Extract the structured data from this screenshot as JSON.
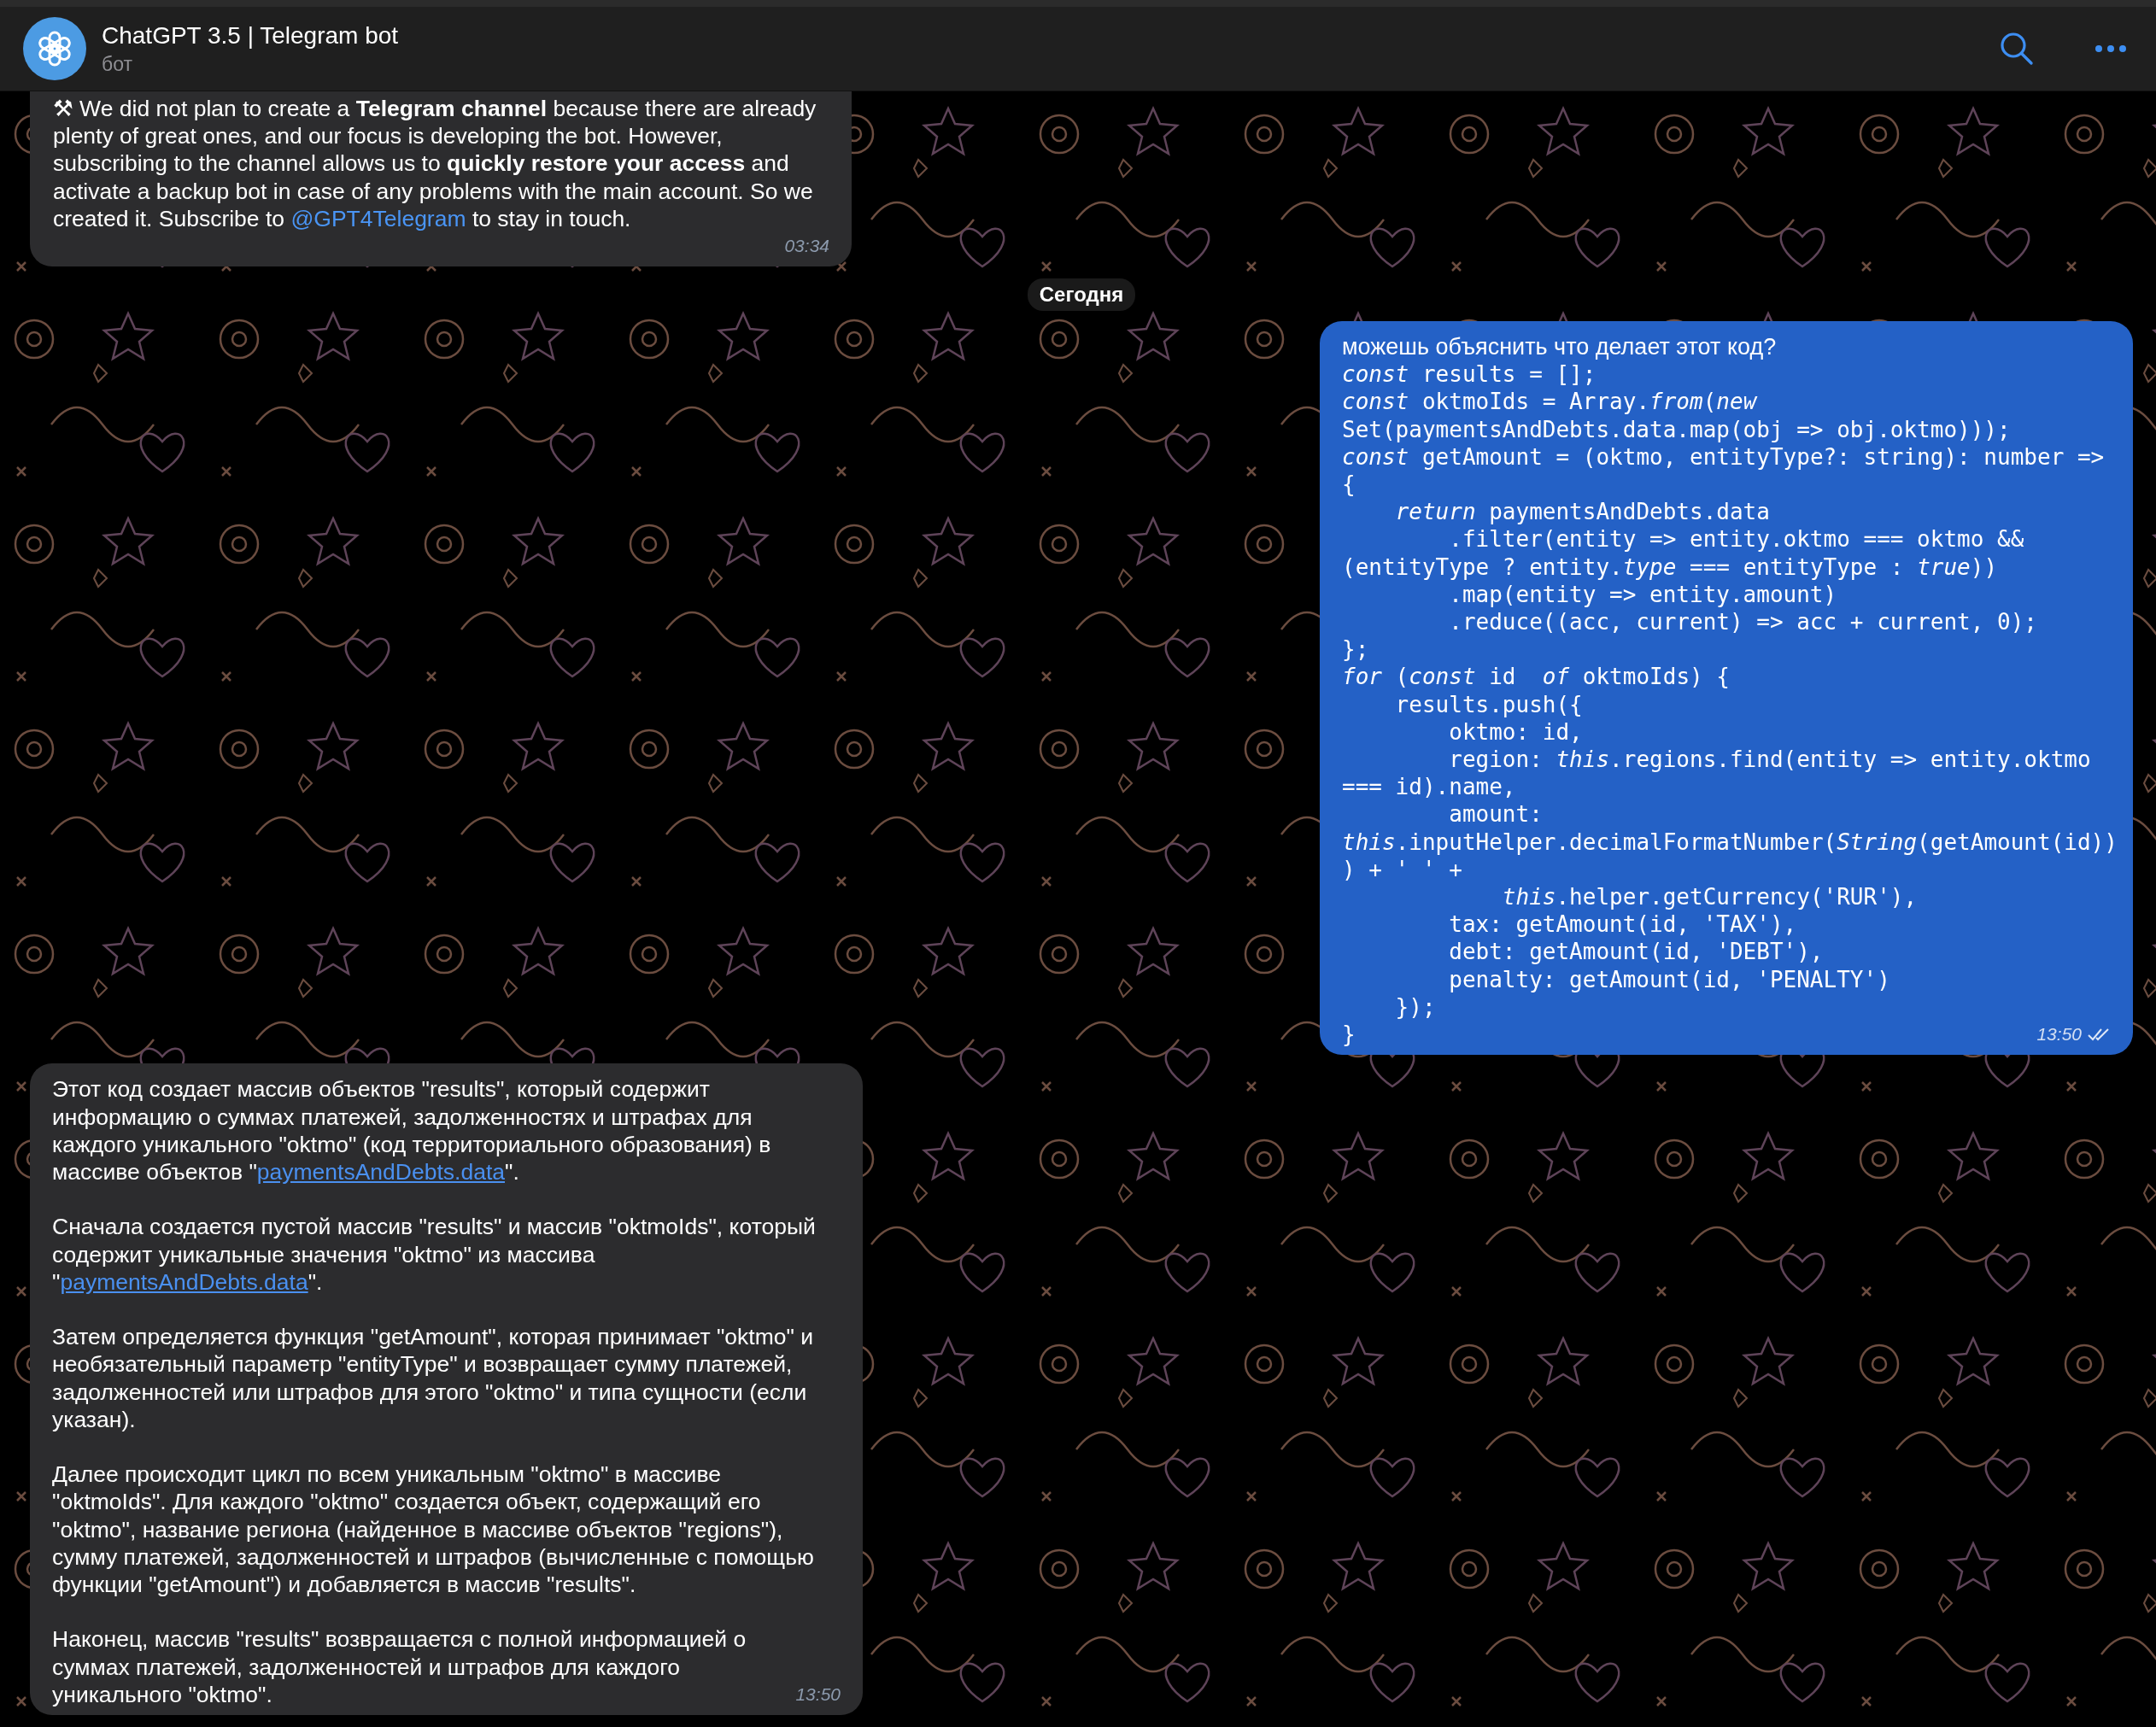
{
  "header": {
    "title": "ChatGPT 3.5 | Telegram bot",
    "subtitle": "бот"
  },
  "messages": [
    {
      "kind": "incoming",
      "time": "03:34",
      "paragraphs": [
        {
          "parts": [
            {
              "kind": "text",
              "text": "⚒ We did not plan to create a **Telegram channel** because there are already plenty of great ones, and our focus is developing the bot. However, subscribing to the channel allows us to **quickly restore your access** and activate a backup bot in case of any problems with the main account. So we created it. Subscribe to "
            },
            {
              "kind": "link",
              "text": "@GPT4Telegram"
            },
            {
              "kind": "text",
              "text": " to stay in touch."
            }
          ]
        }
      ]
    },
    {
      "kind": "date",
      "label": "Сегодня"
    },
    {
      "kind": "outgoing",
      "time": "13:50",
      "read": true,
      "text": "можешь объяснить что делает этот код?",
      "code_lines": [
        "*const* results = [];",
        "*const* oktmoIds = Array.*from*(*new*",
        "Set(paymentsAndDebts.data.map(obj => obj.oktmo)));",
        "*const* getAmount = (oktmo, entityType?: string): number =>",
        "{",
        "    *return* paymentsAndDebts.data",
        "        .filter(entity => entity.oktmo === oktmo &&",
        "(entityType ? entity.*type* === entityType : *true*))",
        "        .map(entity => entity.amount)",
        "        .reduce((acc, current) => acc + current, 0);",
        "};",
        "*for* (*const* id  *of* oktmoIds) {",
        "    results.push({",
        "        oktmo: id,",
        "        region: *this*.regions.find(entity => entity.oktmo",
        "=== id).name,",
        "        amount:",
        "*this*.inputHelper.decimalFormatNumber(*String*(getAmount(id))",
        ") + ' ' +",
        "            *this*.helper.getCurrency('RUR'),",
        "        tax: getAmount(id, 'TAX'),",
        "        debt: getAmount(id, 'DEBT'),",
        "        penalty: getAmount(id, 'PENALTY')",
        "    });",
        "}"
      ]
    },
    {
      "kind": "incoming",
      "time": "13:50",
      "paragraphs": [
        {
          "parts": [
            {
              "kind": "text",
              "text": "Этот код создает массив объектов \"results\", который содержит информацию о суммах платежей, задолженностях и штрафах для каждого уникального \"oktmo\" (код территориального образования) в массиве объектов \""
            },
            {
              "kind": "link",
              "text": "paymentsAndDebts.data"
            },
            {
              "kind": "text",
              "text": "\"."
            }
          ]
        },
        {
          "parts": [
            {
              "kind": "text",
              "text": "Сначала создается пустой массив \"results\" и массив \"oktmoIds\", который содержит уникальные значения \"oktmo\" из массива \""
            },
            {
              "kind": "link",
              "text": "paymentsAndDebts.data"
            },
            {
              "kind": "text",
              "text": "\"."
            }
          ]
        },
        {
          "parts": [
            {
              "kind": "text",
              "text": "Затем определяется функция \"getAmount\", которая принимает \"oktmo\" и необязательный параметр \"entityType\" и возвращает сумму платежей, задолженностей или штрафов для этого \"oktmo\" и типа сущности (если указан)."
            }
          ]
        },
        {
          "parts": [
            {
              "kind": "text",
              "text": "Далее происходит цикл по всем уникальным \"oktmo\" в массиве \"oktmoIds\". Для каждого \"oktmo\" создается объект, содержащий его \"oktmo\", название региона (найденное в массиве объектов \"regions\"), сумму платежей, задолженностей и штрафов (вычисленные с помощью функции \"getAmount\") и добавляется в массив \"results\"."
            }
          ]
        },
        {
          "parts": [
            {
              "kind": "text",
              "text": "Наконец, массив \"results\" возвращается с полной информацией о суммах платежей, задолженностей и штрафов для каждого уникального \"oktmo\"."
            }
          ]
        }
      ]
    }
  ]
}
